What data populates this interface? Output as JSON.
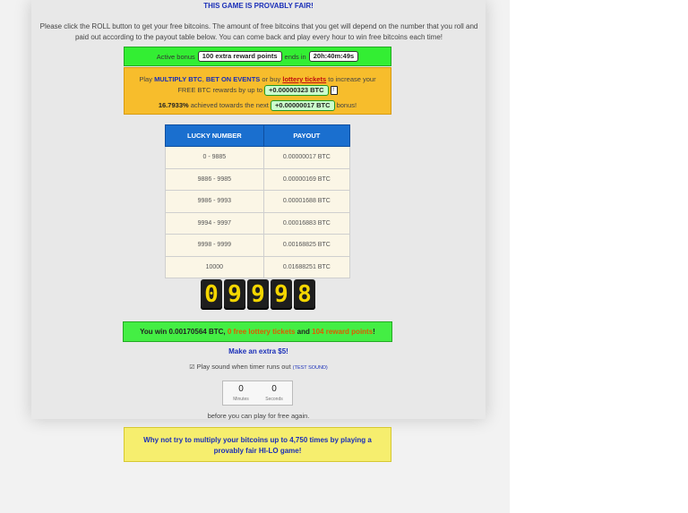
{
  "fair_title": "THIS GAME IS PROVABLY FAIR!",
  "intro": "Please click the ROLL button to get your free bitcoins. The amount of free bitcoins that you get will depend on the number that you roll and paid out according to the payout table below. You can come back and play every hour to win free bitcoins each time!",
  "bonus": {
    "prefix": "Active bonus",
    "points": "100 extra reward points",
    "ends_in": "ends in",
    "time_left": "20h:40m:49s"
  },
  "promo": {
    "play": "Play",
    "multiply": "MULTIPLY BTC",
    "comma": ",",
    "bet_events": "BET ON EVENTS",
    "or_buy": "or buy",
    "lottery": "lottery tickets",
    "to_increase": "to increase your",
    "free_btc": "FREE BTC rewards by up to",
    "increase_value": "+0.00000323 BTC",
    "info_icon": "!",
    "percent": "16.7933%",
    "achieved": "achieved towards the next",
    "next_bonus": "+0.00000017 BTC",
    "bonus_word": "bonus!"
  },
  "payout_table": {
    "headers": [
      "LUCKY NUMBER",
      "PAYOUT"
    ],
    "rows": [
      [
        "0 - 9885",
        "0.00000017 BTC"
      ],
      [
        "9886 - 9985",
        "0.00000169 BTC"
      ],
      [
        "9986 - 9993",
        "0.00001688 BTC"
      ],
      [
        "9994 - 9997",
        "0.00016883 BTC"
      ],
      [
        "9998 - 9999",
        "0.00168825 BTC"
      ],
      [
        "10000",
        "0.01688251 BTC"
      ]
    ]
  },
  "roll_digits": [
    "0",
    "9",
    "9",
    "9",
    "8"
  ],
  "win": {
    "prefix": "You win 0.00170564 BTC,",
    "tickets": "0 free lottery tickets",
    "and": "and",
    "points": "104 reward points",
    "suffix": "!"
  },
  "extra_link": "Make an extra $5!",
  "sound": {
    "label": "Play sound when timer runs out",
    "test": "(TEST SOUND)"
  },
  "timer": {
    "minutes": "0",
    "minutes_label": "Minutes",
    "seconds": "0",
    "seconds_label": "Seconds"
  },
  "before_text": "before you can play for free again.",
  "hilo": {
    "line1": "Why not try to multiply your bitcoins up to 4,750 times by playing a",
    "line2": "provably fair HI-LO game!"
  }
}
